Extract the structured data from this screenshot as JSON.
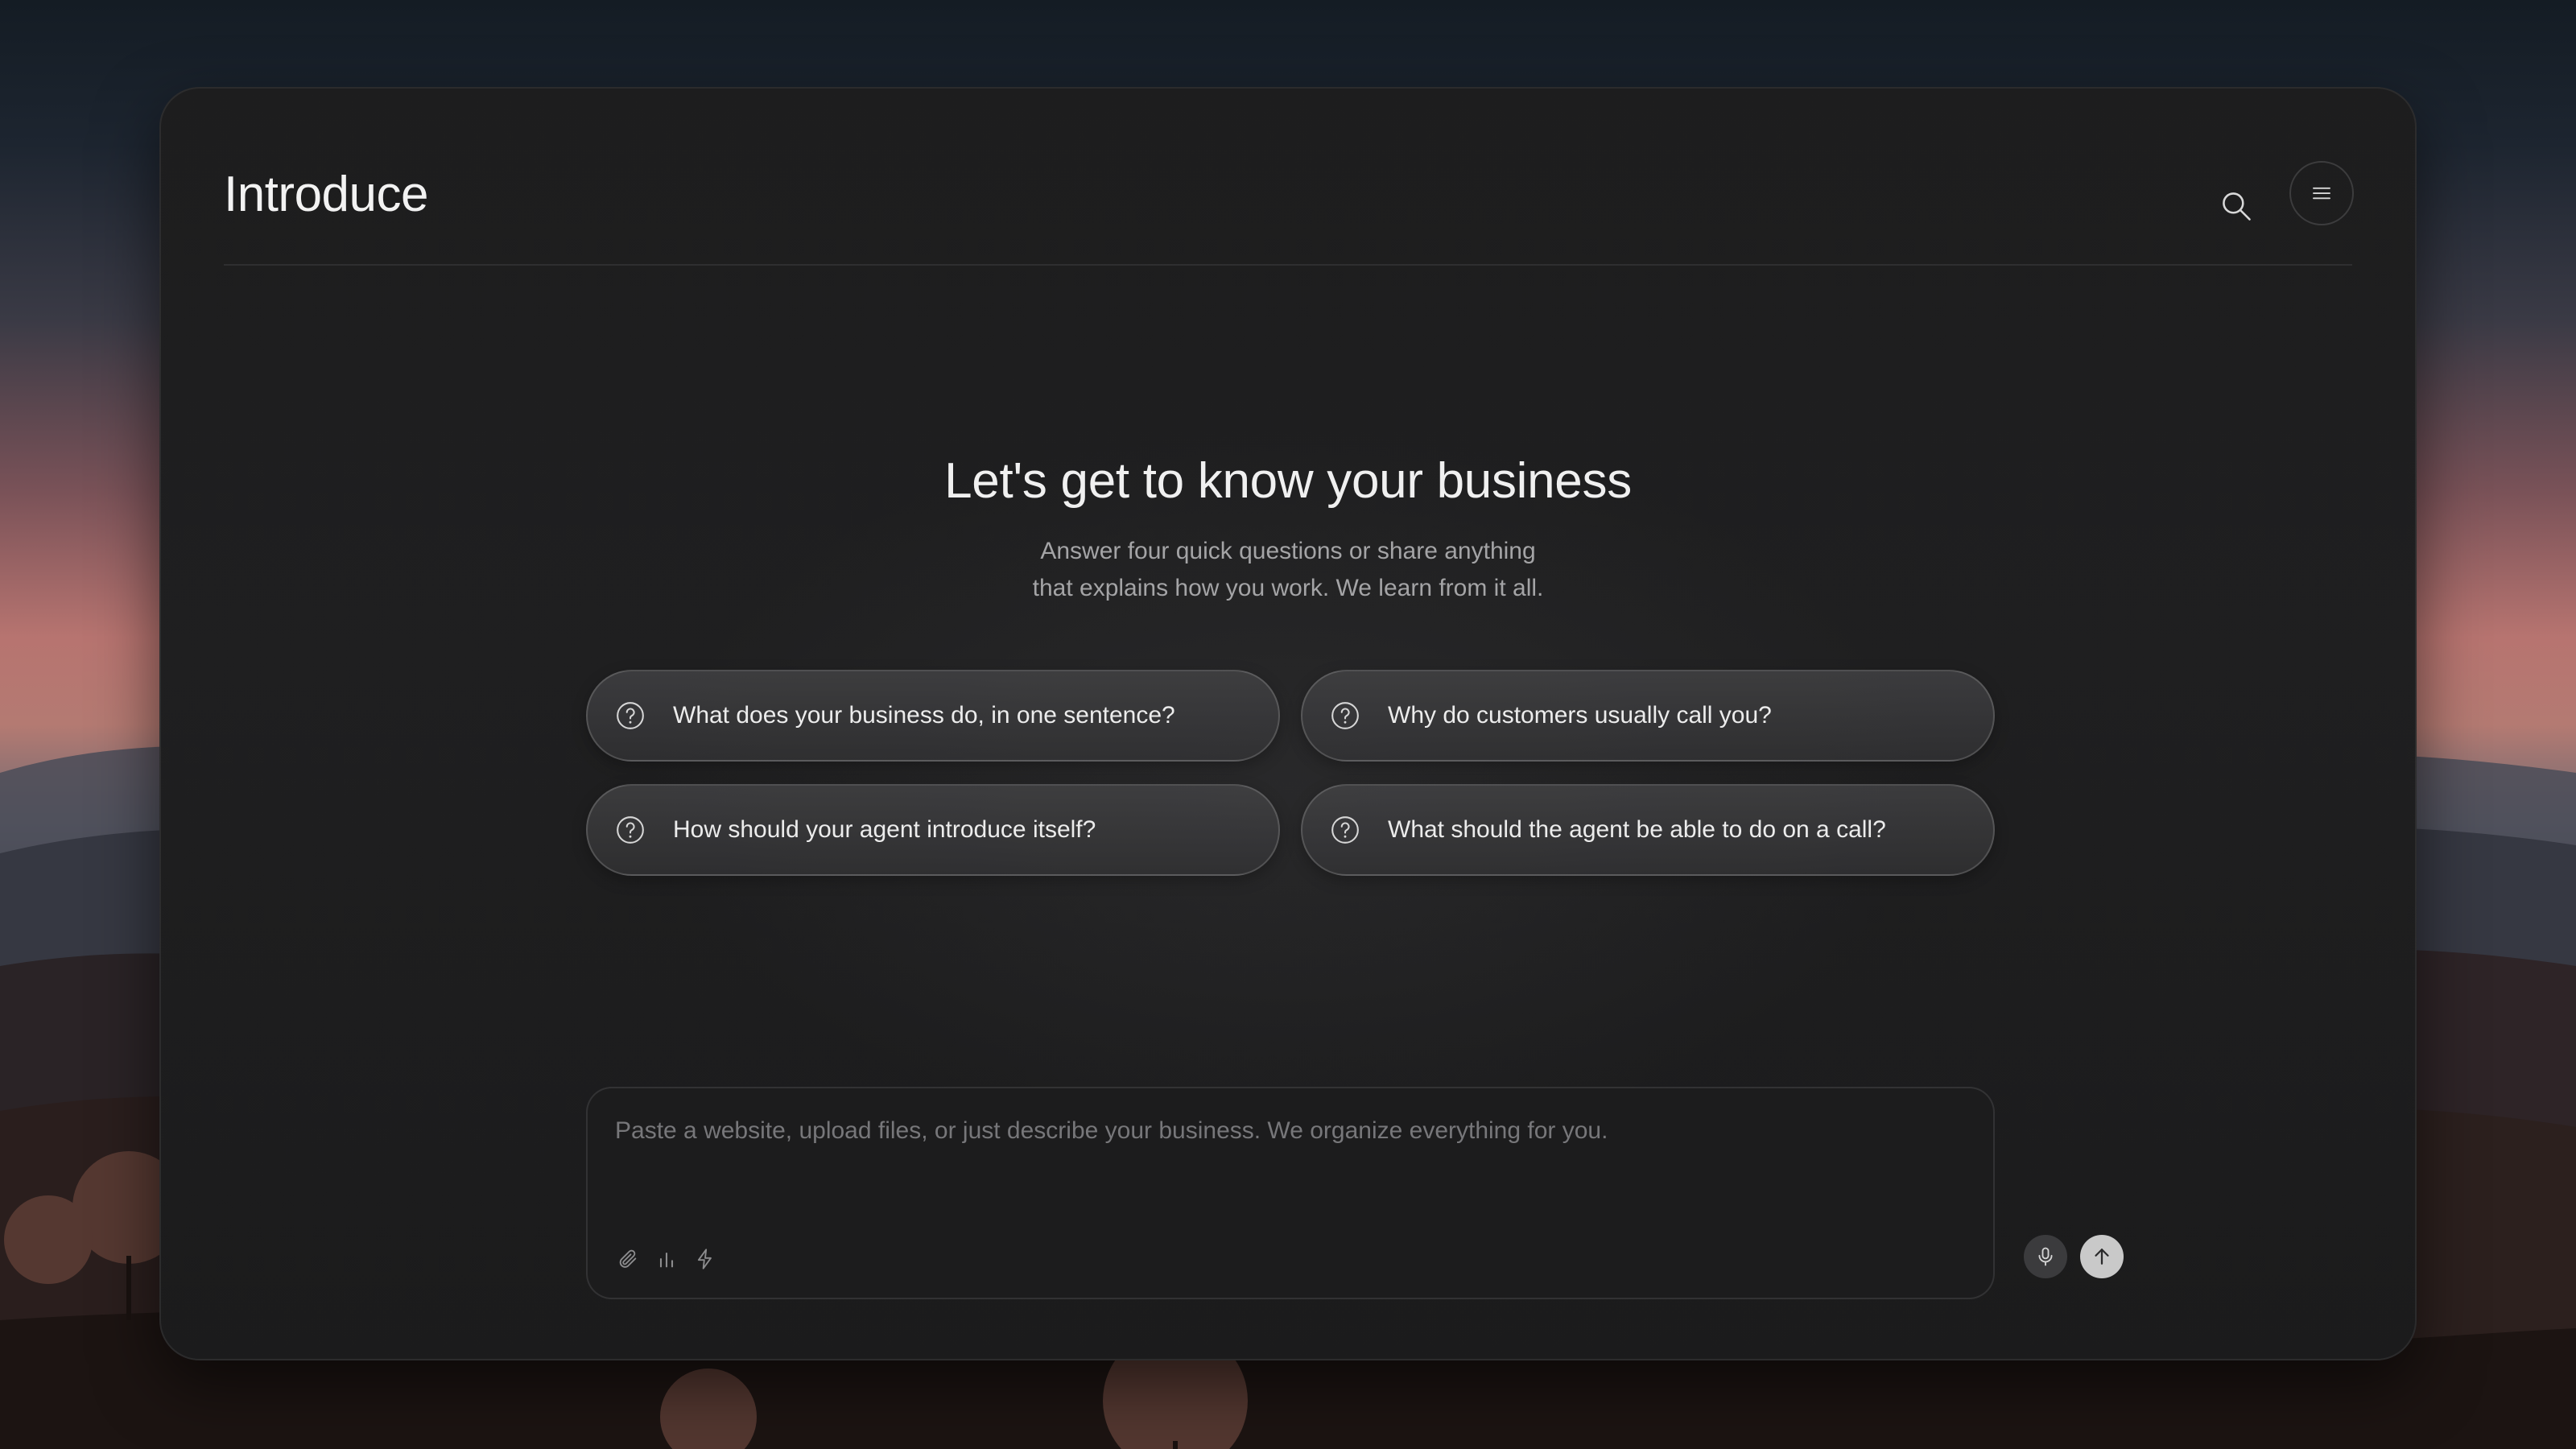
{
  "app": {
    "title": "Introduce"
  },
  "header": {
    "search_icon": "search-icon",
    "menu_icon": "hamburger-menu-icon"
  },
  "hero": {
    "title": "Let's get to know your business",
    "subtitle_line1": "Answer four quick questions or share anything",
    "subtitle_line2": "that explains how you work. We learn from it all."
  },
  "questions": [
    {
      "label": "What does your business do, in one sentence?",
      "icon": "question-circle-icon"
    },
    {
      "label": "Why do customers usually call you?",
      "icon": "question-circle-icon"
    },
    {
      "label": "How should your agent introduce itself?",
      "icon": "question-circle-icon"
    },
    {
      "label": "What should the agent be able to do on a call?",
      "icon": "question-circle-icon"
    }
  ],
  "composer": {
    "value": "",
    "placeholder": "Paste a website, upload files, or just describe your business. We organize everything for you.",
    "tools": [
      "paperclip-icon",
      "bar-chart-icon",
      "lightning-icon"
    ],
    "mic_icon": "microphone-icon",
    "send_icon": "arrow-up-icon"
  },
  "colors": {
    "panel": "#1e1e1f",
    "chip": "#3f3f41",
    "text": "#f0f0f0",
    "muted": "#a4a4a6",
    "send_button": "#c9c9c9",
    "sunset": "#b77470"
  }
}
